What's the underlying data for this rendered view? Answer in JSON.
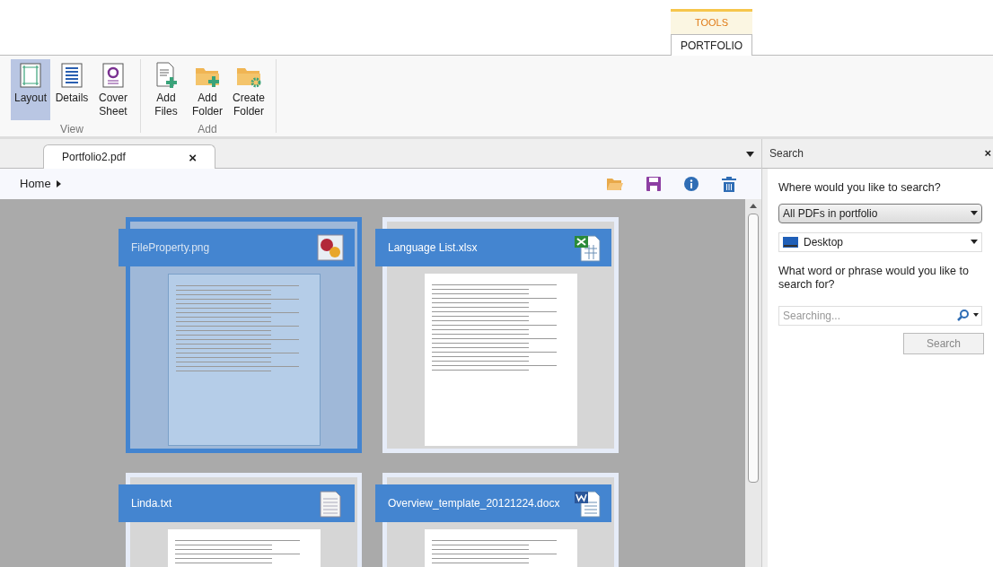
{
  "ribbon_tabs": [
    {
      "label": "TOOLS",
      "selected": false
    },
    {
      "label": "PORTFOLIO",
      "selected": true
    }
  ],
  "ribbon_groups": [
    {
      "label": "View",
      "buttons": [
        {
          "label": "Layout",
          "selected": true
        },
        {
          "label": "Details",
          "selected": false
        },
        {
          "label": "Cover\nSheet",
          "selected": false
        }
      ]
    },
    {
      "label": "Add",
      "buttons": [
        {
          "label": "Add\nFiles",
          "selected": false
        },
        {
          "label": "Add\nFolder",
          "selected": false
        },
        {
          "label": "Create\nFolder",
          "selected": false
        }
      ]
    }
  ],
  "document_tab": {
    "title": "Portfolio2.pdf",
    "close": "×"
  },
  "breadcrumb": {
    "label": "Home"
  },
  "files": [
    {
      "name": "FileProperty.png",
      "kind": "image",
      "selected": true
    },
    {
      "name": "Language List.xlsx",
      "kind": "spreadsheet",
      "selected": false
    },
    {
      "name": "Linda.txt",
      "kind": "text",
      "selected": false
    },
    {
      "name": "Overview_template_20121224.docx",
      "kind": "document",
      "selected": false
    }
  ],
  "search_panel": {
    "title": "Search",
    "close": "×",
    "where_label": "Where would you like to search?",
    "scope": "All PDFs in portfolio",
    "location": "Desktop",
    "what_label": "What word or phrase would you like to search for?",
    "placeholder": "Searching...",
    "button": "Search"
  }
}
